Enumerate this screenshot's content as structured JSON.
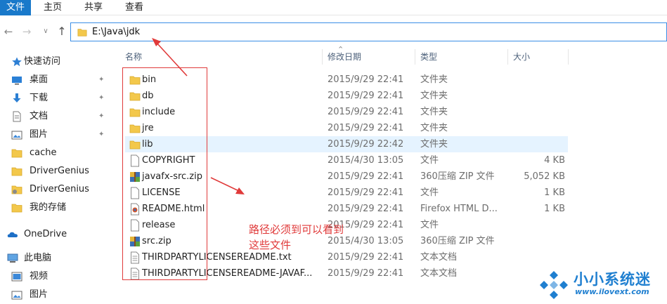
{
  "ribbon": {
    "tabs": [
      "文件",
      "主页",
      "共享",
      "查看"
    ]
  },
  "address": {
    "path": "E:\\Java\\jdk"
  },
  "sidebar": {
    "items": [
      {
        "label": "快速访问",
        "icon": "star-icon"
      },
      {
        "label": "桌面",
        "icon": "desktop-icon",
        "pinned": true
      },
      {
        "label": "下载",
        "icon": "download-icon",
        "pinned": true
      },
      {
        "label": "文档",
        "icon": "document-icon",
        "pinned": true
      },
      {
        "label": "图片",
        "icon": "pictures-icon",
        "pinned": true
      },
      {
        "label": "cache",
        "icon": "folder-icon"
      },
      {
        "label": "DriverGenius",
        "icon": "folder-icon"
      },
      {
        "label": "DriverGenius",
        "icon": "app-folder-icon"
      },
      {
        "label": "我的存储",
        "icon": "folder-icon"
      },
      {
        "label": "OneDrive",
        "icon": "cloud-icon"
      },
      {
        "label": "此电脑",
        "icon": "computer-icon"
      },
      {
        "label": "视频",
        "icon": "video-icon"
      },
      {
        "label": "图片",
        "icon": "pictures-icon"
      }
    ]
  },
  "columns": {
    "name": "名称",
    "date": "修改日期",
    "type": "类型",
    "size": "大小"
  },
  "files": [
    {
      "name": "bin",
      "date": "2015/9/29 22:41",
      "type": "文件夹",
      "size": "",
      "icon": "folder-icon"
    },
    {
      "name": "db",
      "date": "2015/9/29 22:41",
      "type": "文件夹",
      "size": "",
      "icon": "folder-icon"
    },
    {
      "name": "include",
      "date": "2015/9/29 22:41",
      "type": "文件夹",
      "size": "",
      "icon": "folder-icon"
    },
    {
      "name": "jre",
      "date": "2015/9/29 22:41",
      "type": "文件夹",
      "size": "",
      "icon": "folder-icon"
    },
    {
      "name": "lib",
      "date": "2015/9/29 22:42",
      "type": "文件夹",
      "size": "",
      "icon": "folder-icon",
      "selected": true
    },
    {
      "name": "COPYRIGHT",
      "date": "2015/4/30 13:05",
      "type": "文件",
      "size": "4 KB",
      "icon": "file-icon"
    },
    {
      "name": "javafx-src.zip",
      "date": "2015/9/29 22:41",
      "type": "360压缩 ZIP 文件",
      "size": "5,052 KB",
      "icon": "zip-icon"
    },
    {
      "name": "LICENSE",
      "date": "2015/9/29 22:41",
      "type": "文件",
      "size": "1 KB",
      "icon": "file-icon"
    },
    {
      "name": "README.html",
      "date": "2015/9/29 22:41",
      "type": "Firefox HTML D...",
      "size": "1 KB",
      "icon": "html-file-icon"
    },
    {
      "name": "release",
      "date": "2015/9/29 22:41",
      "type": "文件",
      "size": "",
      "icon": "file-icon"
    },
    {
      "name": "src.zip",
      "date": "2015/4/30 13:05",
      "type": "360压缩 ZIP 文件",
      "size": "",
      "icon": "zip-icon"
    },
    {
      "name": "THIRDPARTYLICENSEREADME.txt",
      "date": "2015/9/29 22:41",
      "type": "文本文档",
      "size": "",
      "icon": "text-file-icon"
    },
    {
      "name": "THIRDPARTYLICENSEREADME-JAVAF...",
      "date": "2015/9/29 22:41",
      "type": "文本文档",
      "size": "",
      "icon": "text-file-icon"
    }
  ],
  "annotation": {
    "text": "路径必须到可以看到这些文件",
    "color": "#e03a3a"
  },
  "watermark": {
    "title": "小小系统迷",
    "url": "www.ilovext.com"
  },
  "colors": {
    "accent": "#1979ca",
    "selection": "#e5f3ff",
    "folder": "#f3c84b"
  }
}
